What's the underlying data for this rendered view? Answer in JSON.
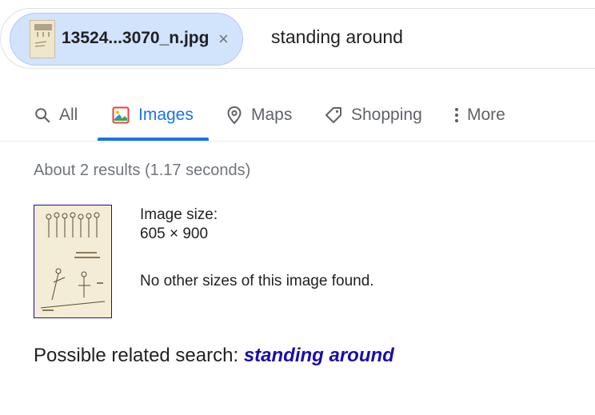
{
  "search": {
    "chip_filename": "13524...3070_n.jpg",
    "chip_close": "×",
    "query": "standing around"
  },
  "tabs": [
    {
      "label": "All",
      "icon": "search-icon"
    },
    {
      "label": "Images",
      "icon": "images-icon",
      "active": true
    },
    {
      "label": "Maps",
      "icon": "map-pin-icon"
    },
    {
      "label": "Shopping",
      "icon": "tag-icon"
    },
    {
      "label": "More",
      "icon": "more-vert-icon"
    }
  ],
  "results": {
    "stats": "About 2 results (1.17 seconds)",
    "image_size_label": "Image size:",
    "image_size_value": "605 × 900",
    "no_other_sizes": "No other sizes of this image found.",
    "related_prefix": "Possible related search:",
    "related_query": "standing around"
  },
  "colors": {
    "accent": "#1a73e8",
    "chip_bg": "#d2e3fc",
    "link": "#1a0dab",
    "muted": "#70757a"
  }
}
